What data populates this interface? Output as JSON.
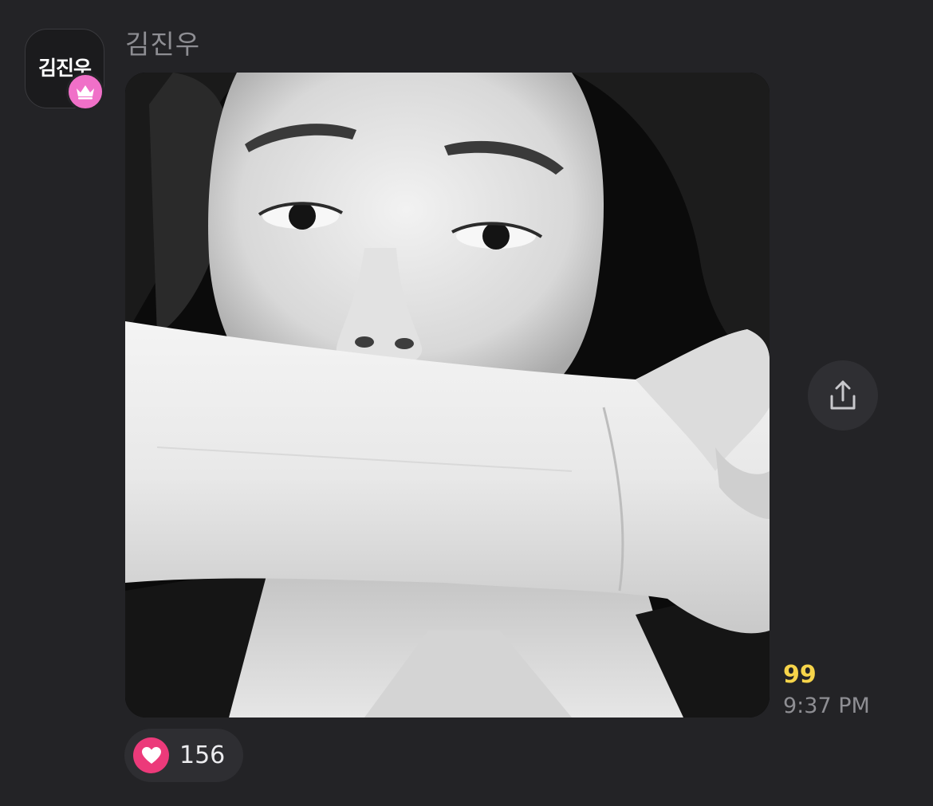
{
  "message": {
    "sender": {
      "name": "김진우",
      "avatar_text": "김진우",
      "badge_icon": "crown-icon",
      "badge_color": "#f070c8"
    },
    "photo": {
      "kind": "black-and-white selfie photo"
    },
    "share_icon": "share-icon",
    "unread_count": "99",
    "unread_color": "#f6d44a",
    "time": "9:37 PM",
    "reaction": {
      "icon": "heart-icon",
      "color": "#ec3a7a",
      "count": "156"
    }
  }
}
